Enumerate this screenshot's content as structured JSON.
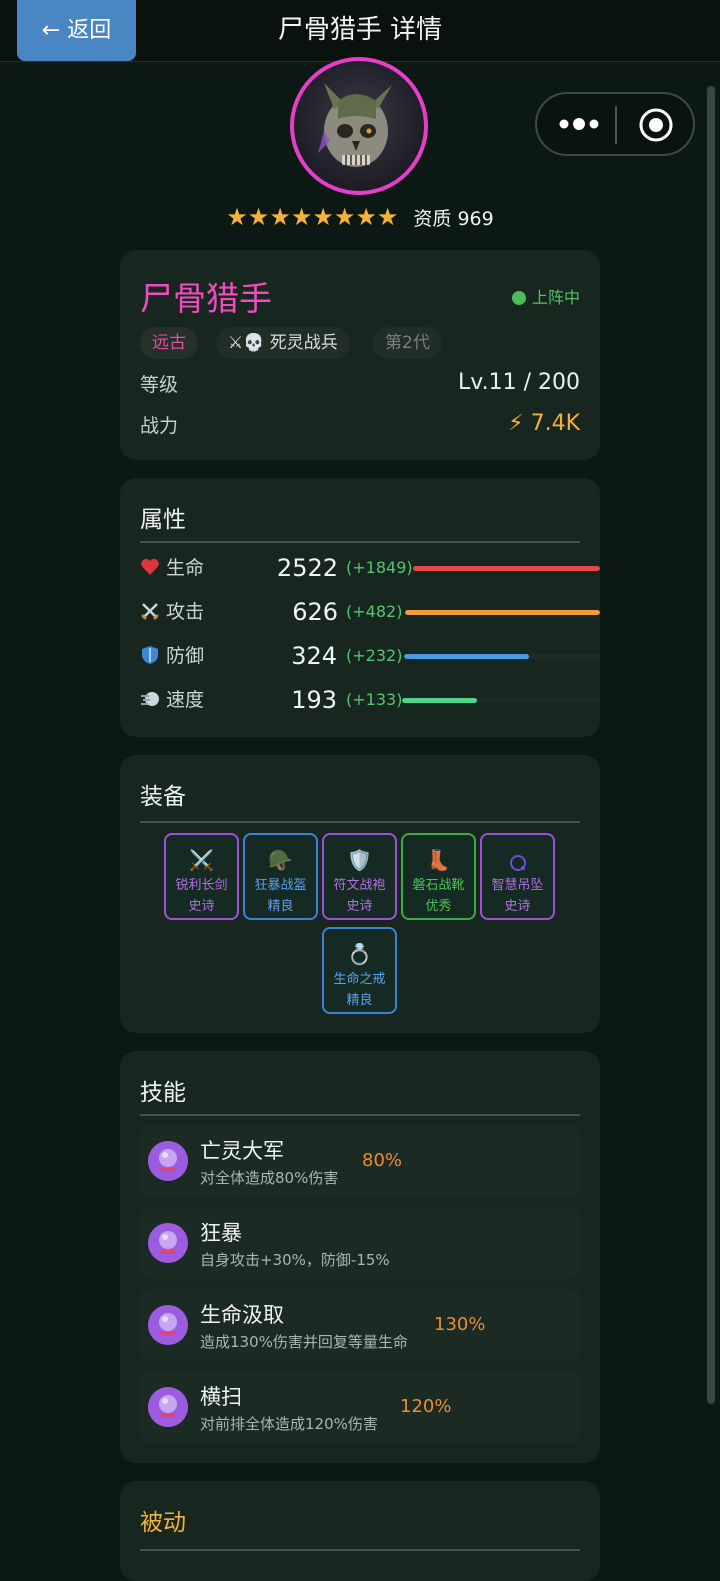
{
  "topbar": {
    "back_label": "← 返回",
    "title": "尸骨猎手 详情"
  },
  "hero": {
    "stars": "★★★★★★★★",
    "star_count": 8,
    "aptitude_label": "资质 969",
    "name": "尸骨猎手",
    "status": "上阵中",
    "tags": {
      "era": "远古",
      "race": "⚔💀 死灵战兵",
      "generation": "第2代"
    },
    "level_label": "等级",
    "level_value": "Lv.11 / 200",
    "power_label": "战力",
    "power_value": "⚡ 7.4K"
  },
  "attributes": {
    "title": "属性",
    "items": [
      {
        "name": "生命",
        "value": "2522",
        "bonus": "(+1849)",
        "fill": 1.0,
        "color": "#e84848"
      },
      {
        "name": "攻击",
        "value": "626",
        "bonus": "(+482)",
        "fill": 1.0,
        "color": "#f39a3a"
      },
      {
        "name": "防御",
        "value": "324",
        "bonus": "(+232)",
        "fill": 0.64,
        "color": "#4a9be6"
      },
      {
        "name": "速度",
        "value": "193",
        "bonus": "(+133)",
        "fill": 0.38,
        "color": "#4fd88b"
      }
    ]
  },
  "equipment": {
    "title": "装备",
    "items": [
      {
        "name": "锐利长剑",
        "rarity": "史诗",
        "icon": "sword-icon"
      },
      {
        "name": "狂暴战盔",
        "rarity": "精良",
        "icon": "helmet-icon"
      },
      {
        "name": "符文战袍",
        "rarity": "史诗",
        "icon": "shield-icon"
      },
      {
        "name": "磐石战靴",
        "rarity": "优秀",
        "icon": "boot-icon"
      },
      {
        "name": "智慧吊坠",
        "rarity": "史诗",
        "icon": "pendant-icon"
      },
      {
        "name": "生命之戒",
        "rarity": "精良",
        "icon": "ring-icon"
      }
    ]
  },
  "skills": {
    "title": "技能",
    "items": [
      {
        "name": "亡灵大军",
        "desc": "对全体造成80%伤害",
        "pct": "80%"
      },
      {
        "name": "狂暴",
        "desc": "自身攻击+30%，防御-15%",
        "pct": ""
      },
      {
        "name": "生命汲取",
        "desc": "造成130%伤害并回复等量生命",
        "pct": "130%"
      },
      {
        "name": "横扫",
        "desc": "对前排全体造成120%伤害",
        "pct": "120%"
      }
    ]
  },
  "passive": {
    "title": "被动"
  }
}
